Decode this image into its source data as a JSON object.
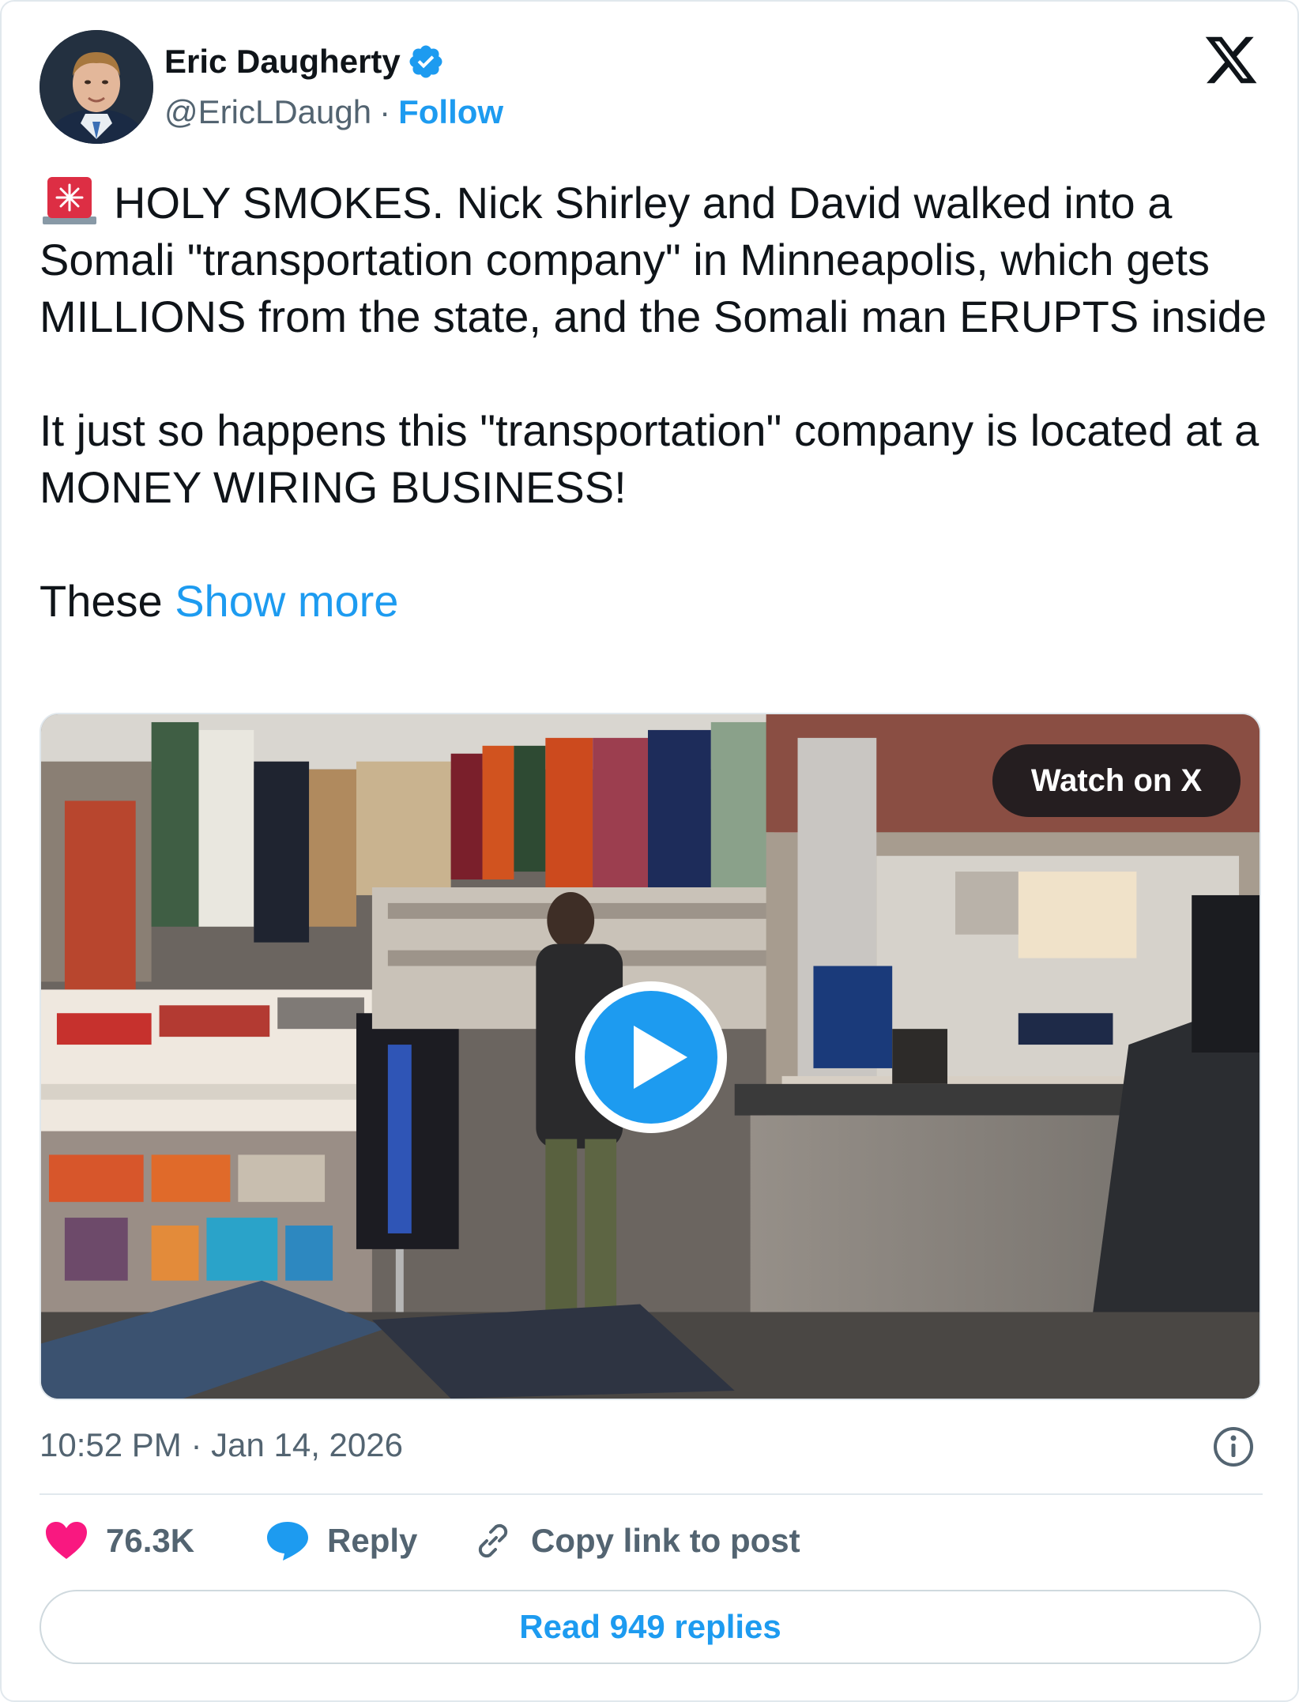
{
  "author": {
    "name": "Eric Daugherty",
    "handle": "@EricLDaugh",
    "separator": "·",
    "follow_label": "Follow",
    "verified_badge_color": "#1d9bf0"
  },
  "brand_icon": "x-logo-icon",
  "tweet": {
    "paragraph1": "HOLY SMOKES. Nick Shirley and David walked into a Somali \"transportation company\" in Minneapolis, which gets MILLIONS from the state, and the Somali man ERUPTS inside",
    "paragraph2": "It just so happens this \"transportation\" company is located at a MONEY WIRING BUSINESS!",
    "paragraph3_start": "These",
    "show_more_label": "Show more",
    "emoji_icon": "rotating-light-icon"
  },
  "media": {
    "watch_label": "Watch on X",
    "play_icon": "play-icon"
  },
  "timestamp": "10:52 PM · Jan 14, 2026",
  "actions": {
    "likes_count": "76.3K",
    "reply_label": "Reply",
    "copy_link_label": "Copy link to post",
    "read_replies_label": "Read 949 replies"
  },
  "colors": {
    "accent": "#1d9bf0",
    "like": "#f91880",
    "text_secondary": "#536471"
  }
}
